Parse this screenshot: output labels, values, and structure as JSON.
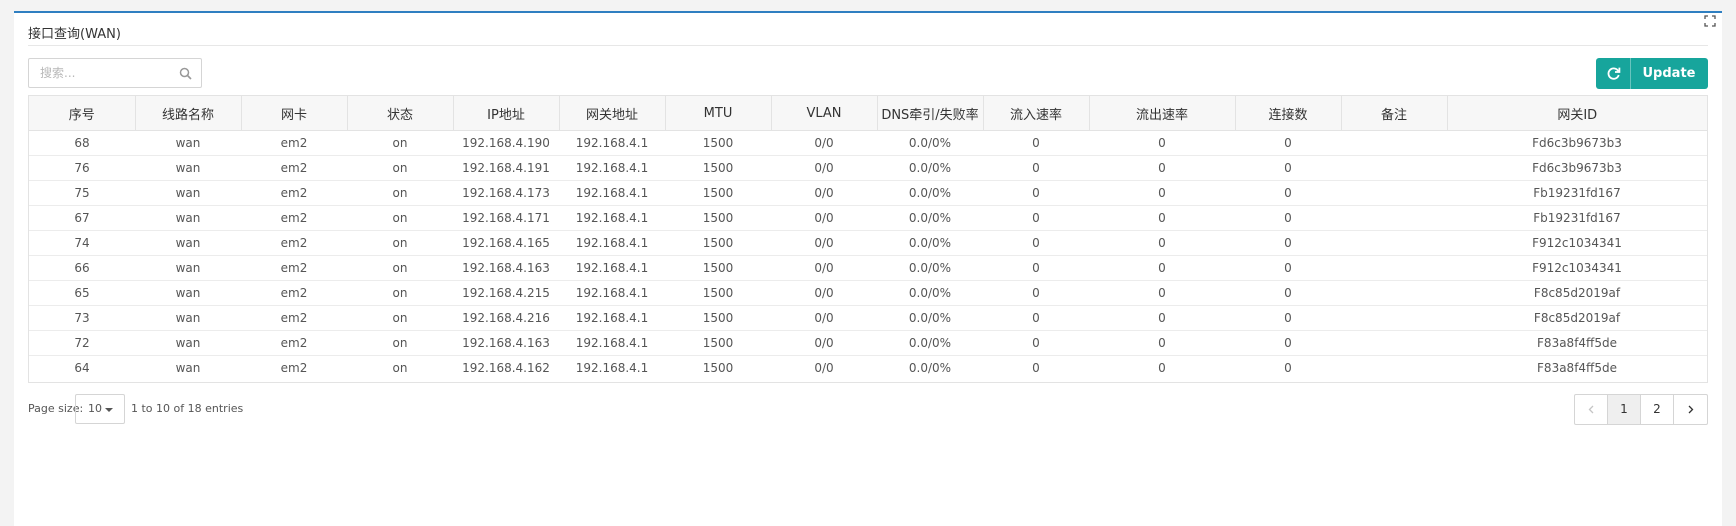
{
  "panel": {
    "title": "接口查询(WAN)"
  },
  "search": {
    "placeholder": "搜索..."
  },
  "toolbar": {
    "update_label": "Update"
  },
  "table": {
    "columns": [
      "序号",
      "线路名称",
      "网卡",
      "状态",
      "IP地址",
      "网关地址",
      "MTU",
      "VLAN",
      "DNS牵引/失败率",
      "流入速率",
      "流出速率",
      "连接数",
      "备注",
      "网关ID"
    ],
    "rows": [
      [
        "68",
        "wan",
        "em2",
        "on",
        "192.168.4.190",
        "192.168.4.1",
        "1500",
        "0/0",
        "0.0/0%",
        "0",
        "0",
        "0",
        "",
        "Fd6c3b9673b3"
      ],
      [
        "76",
        "wan",
        "em2",
        "on",
        "192.168.4.191",
        "192.168.4.1",
        "1500",
        "0/0",
        "0.0/0%",
        "0",
        "0",
        "0",
        "",
        "Fd6c3b9673b3"
      ],
      [
        "75",
        "wan",
        "em2",
        "on",
        "192.168.4.173",
        "192.168.4.1",
        "1500",
        "0/0",
        "0.0/0%",
        "0",
        "0",
        "0",
        "",
        "Fb19231fd167"
      ],
      [
        "67",
        "wan",
        "em2",
        "on",
        "192.168.4.171",
        "192.168.4.1",
        "1500",
        "0/0",
        "0.0/0%",
        "0",
        "0",
        "0",
        "",
        "Fb19231fd167"
      ],
      [
        "74",
        "wan",
        "em2",
        "on",
        "192.168.4.165",
        "192.168.4.1",
        "1500",
        "0/0",
        "0.0/0%",
        "0",
        "0",
        "0",
        "",
        "F912c1034341"
      ],
      [
        "66",
        "wan",
        "em2",
        "on",
        "192.168.4.163",
        "192.168.4.1",
        "1500",
        "0/0",
        "0.0/0%",
        "0",
        "0",
        "0",
        "",
        "F912c1034341"
      ],
      [
        "65",
        "wan",
        "em2",
        "on",
        "192.168.4.215",
        "192.168.4.1",
        "1500",
        "0/0",
        "0.0/0%",
        "0",
        "0",
        "0",
        "",
        "F8c85d2019af"
      ],
      [
        "73",
        "wan",
        "em2",
        "on",
        "192.168.4.216",
        "192.168.4.1",
        "1500",
        "0/0",
        "0.0/0%",
        "0",
        "0",
        "0",
        "",
        "F8c85d2019af"
      ],
      [
        "72",
        "wan",
        "em2",
        "on",
        "192.168.4.163",
        "192.168.4.1",
        "1500",
        "0/0",
        "0.0/0%",
        "0",
        "0",
        "0",
        "",
        "F83a8f4ff5de"
      ],
      [
        "64",
        "wan",
        "em2",
        "on",
        "192.168.4.162",
        "192.168.4.1",
        "1500",
        "0/0",
        "0.0/0%",
        "0",
        "0",
        "0",
        "",
        "F83a8f4ff5de"
      ]
    ]
  },
  "footer": {
    "page_size_label": "Page size:",
    "page_size_value": "10",
    "entries_info": "1 to 10 of 18 entries",
    "pages": [
      "1",
      "2"
    ]
  },
  "colors": {
    "accent": "#17a59c",
    "panel_border": "#2f7fc1"
  },
  "icons": {
    "expand": "expand-icon",
    "search": "search-icon",
    "refresh": "refresh-icon",
    "caret": "caret-down-icon",
    "prev": "chevron-left-icon",
    "next": "chevron-right-icon"
  }
}
